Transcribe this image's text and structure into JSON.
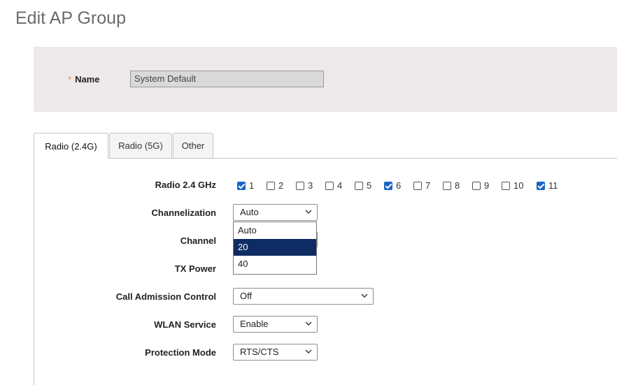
{
  "page": {
    "title": "Edit AP Group"
  },
  "name_field": {
    "label": "Name",
    "required_mark": "*",
    "value": "System Default"
  },
  "tabs": [
    {
      "label": "Radio (2.4G)",
      "active": true
    },
    {
      "label": "Radio (5G)",
      "active": false
    },
    {
      "label": "Other",
      "active": false
    }
  ],
  "radio": {
    "band_label": "Radio 2.4 GHz",
    "channels": [
      {
        "label": "1",
        "checked": true
      },
      {
        "label": "2",
        "checked": false
      },
      {
        "label": "3",
        "checked": false
      },
      {
        "label": "4",
        "checked": false
      },
      {
        "label": "5",
        "checked": false
      },
      {
        "label": "6",
        "checked": true
      },
      {
        "label": "7",
        "checked": false
      },
      {
        "label": "8",
        "checked": false
      },
      {
        "label": "9",
        "checked": false
      },
      {
        "label": "10",
        "checked": false
      },
      {
        "label": "11",
        "checked": true
      }
    ],
    "channelization": {
      "label": "Channelization",
      "value": "Auto",
      "options": [
        {
          "label": "Auto",
          "highlighted": false
        },
        {
          "label": "20",
          "highlighted": true
        },
        {
          "label": "40",
          "highlighted": false
        }
      ]
    },
    "channel": {
      "label": "Channel"
    },
    "tx_power": {
      "label": "TX Power"
    },
    "call_admission_control": {
      "label": "Call Admission Control",
      "value": "Off"
    },
    "wlan_service": {
      "label": "WLAN Service",
      "value": "Enable"
    },
    "protection_mode": {
      "label": "Protection Mode",
      "value": "RTS/CTS"
    }
  },
  "colors": {
    "checkbox_checked": "#1a64c8",
    "dropdown_highlight": "#0f2b63",
    "required_star": "#e98b2f",
    "name_panel_bg": "#ede8ea"
  },
  "icons": {
    "select_arrow": "chevron-down-icon",
    "checkbox_check": "check-icon"
  }
}
